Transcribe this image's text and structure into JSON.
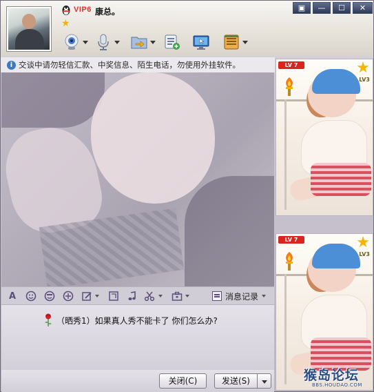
{
  "window": {
    "controls": {
      "skin": "▣",
      "minimize": "—",
      "maximize": "☐",
      "close": "✕"
    }
  },
  "contact": {
    "vip_badge": "VIP6",
    "nickname": "康总。"
  },
  "toolbar": {
    "icons": [
      "video-call-icon",
      "voice-call-icon",
      "send-file-icon",
      "apps-icon",
      "remote-assist-icon",
      "more-apps-icon"
    ]
  },
  "notice": {
    "text": "交谈中请勿轻信汇款、中奖信息、陌生电话，勿使用外挂软件。"
  },
  "format_toolbar": {
    "history_label": "消息记录"
  },
  "input": {
    "message": "（晒秀1）如果真人秀不能卡了 你们怎么办?"
  },
  "buttons": {
    "close": "关闭(C)",
    "send": "发送(S)"
  },
  "show_panels": [
    {
      "level_badge": "LV 7",
      "level_tag": "LV3"
    },
    {
      "level_badge": "LV 7",
      "level_tag": "LV3"
    }
  ],
  "watermark": {
    "title": "猴岛论坛",
    "url": "BBS.HOUDAO.COM"
  },
  "colors": {
    "vip": "#e0312b",
    "accent": "#5a4f7c",
    "watermark": "#2b4d86"
  }
}
